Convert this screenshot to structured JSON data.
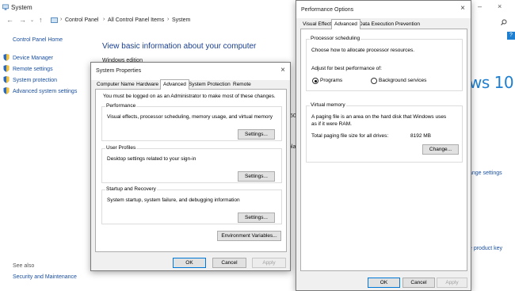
{
  "system": {
    "title": "System",
    "breadcrumbs": [
      "Control Panel",
      "All Control Panel Items",
      "System"
    ],
    "sidebar": {
      "home": "Control Panel Home",
      "items": [
        "Device Manager",
        "Remote settings",
        "System protection",
        "Advanced system settings"
      ],
      "see_also": "See also",
      "security": "Security and Maintenance"
    },
    "heading": "View basic information about your computer",
    "windows_edition": "Windows edition",
    "brand_fragment": "ws 10",
    "frag_35": ".50",
    "frag_pla": "pla",
    "change_settings": "ange settings",
    "product_key": "e product key"
  },
  "system_properties": {
    "title": "System Properties",
    "tabs": [
      "Computer Name",
      "Hardware",
      "Advanced",
      "System Protection",
      "Remote"
    ],
    "active_tab": "Advanced",
    "admin_note": "You must be logged on as an Administrator to make most of these changes.",
    "performance": {
      "title": "Performance",
      "desc": "Visual effects, processor scheduling, memory usage, and virtual memory",
      "button": "Settings..."
    },
    "profiles": {
      "title": "User Profiles",
      "desc": "Desktop settings related to your sign-in",
      "button": "Settings..."
    },
    "startup": {
      "title": "Startup and Recovery",
      "desc": "System startup, system failure, and debugging information",
      "button": "Settings..."
    },
    "env_button": "Environment Variables...",
    "ok": "OK",
    "cancel": "Cancel",
    "apply": "Apply"
  },
  "performance_options": {
    "title": "Performance Options",
    "tabs": [
      "Visual Effects",
      "Advanced",
      "Data Execution Prevention"
    ],
    "active_tab": "Advanced",
    "scheduling": {
      "title": "Processor scheduling",
      "desc": "Choose how to allocate processor resources.",
      "adjust": "Adjust for best performance of:",
      "opt_programs": "Programs",
      "opt_background": "Background services",
      "selected": "Programs"
    },
    "vm": {
      "title": "Virtual memory",
      "desc1": "A paging file is an area on the hard disk that Windows uses",
      "desc2": "as if it were RAM.",
      "total_label": "Total paging file size for all drives:",
      "total_value": "8192 MB",
      "change": "Change..."
    },
    "ok": "OK",
    "cancel": "Cancel",
    "apply": "Apply"
  },
  "colors": {
    "link": "#1a4fa0",
    "accent": "#0078d7",
    "brand_blue": "#1e7fd0"
  }
}
